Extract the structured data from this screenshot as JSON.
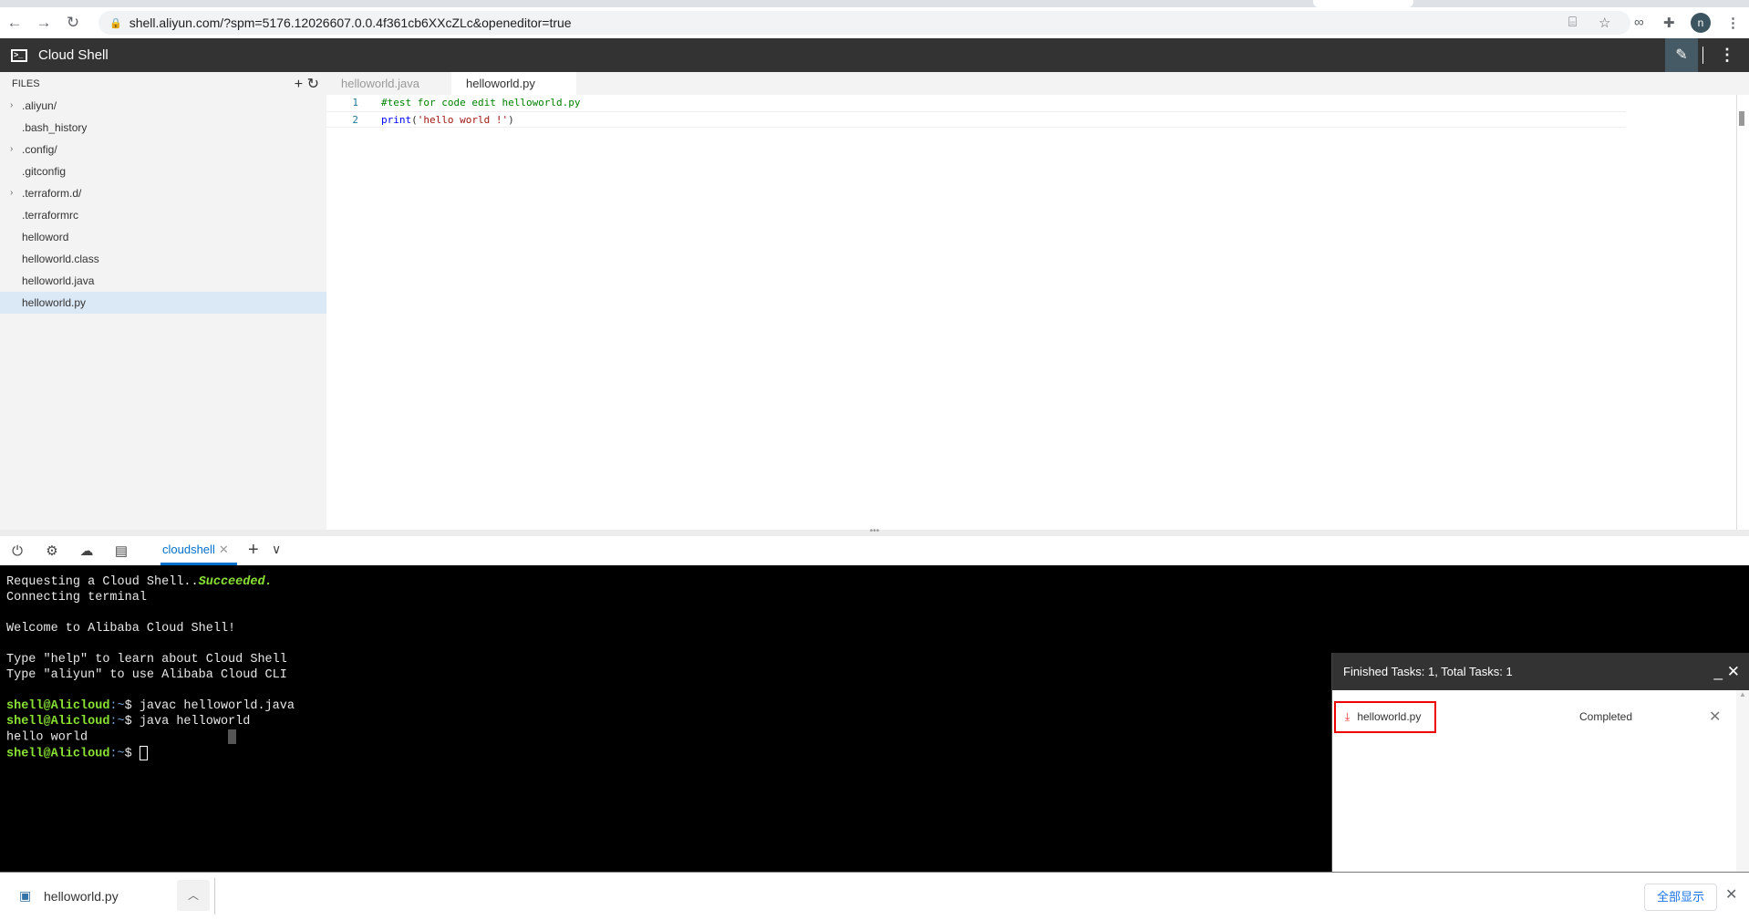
{
  "browser": {
    "url": "shell.aliyun.com/?spm=5176.12026607.0.0.4f361cb6XXcZLc&openeditor=true",
    "avatar_letter": "n"
  },
  "app": {
    "title": "Cloud Shell"
  },
  "sidebar": {
    "header": "FILES",
    "items": [
      {
        "label": ".aliyun/",
        "folder": true
      },
      {
        "label": ".bash_history",
        "folder": false
      },
      {
        "label": ".config/",
        "folder": true
      },
      {
        "label": ".gitconfig",
        "folder": false
      },
      {
        "label": ".terraform.d/",
        "folder": true
      },
      {
        "label": ".terraformrc",
        "folder": false
      },
      {
        "label": "helloword",
        "folder": false
      },
      {
        "label": "helloworld.class",
        "folder": false
      },
      {
        "label": "helloworld.java",
        "folder": false
      },
      {
        "label": "helloworld.py",
        "folder": false,
        "selected": true
      }
    ]
  },
  "editor": {
    "tabs": [
      {
        "label": "helloworld.java"
      },
      {
        "label": "helloworld.py",
        "active": true
      }
    ],
    "lines": [
      {
        "n": "1",
        "comment": "#test for code edit helloworld.py"
      },
      {
        "n": "2",
        "kw": "print",
        "open": "(",
        "str": "'hello world !'",
        "close": ")"
      }
    ]
  },
  "terminal": {
    "tab": "cloudshell",
    "l1": "Requesting a Cloud Shell..",
    "l1ok": "Succeeded.",
    "l2": "Connecting terminal",
    "l3": "Welcome to Alibaba Cloud Shell!",
    "l4": "Type \"help\" to learn about Cloud Shell",
    "l5": "Type \"aliyun\" to use Alibaba Cloud CLI",
    "prompt": "shell@Alicloud",
    "path": ":~",
    "dollar": "$ ",
    "c1": "javac helloworld.java",
    "c2": "java helloworld",
    "out": "hello world"
  },
  "tasks": {
    "header": "Finished Tasks: 1, Total Tasks: 1",
    "file": "helloworld.py",
    "status": "Completed"
  },
  "download_bar": {
    "file": "helloworld.py",
    "show_all": "全部显示"
  },
  "colors": {
    "accent": "#0070cc",
    "prompt": "#8ae234",
    "highlight": "#e00000"
  }
}
